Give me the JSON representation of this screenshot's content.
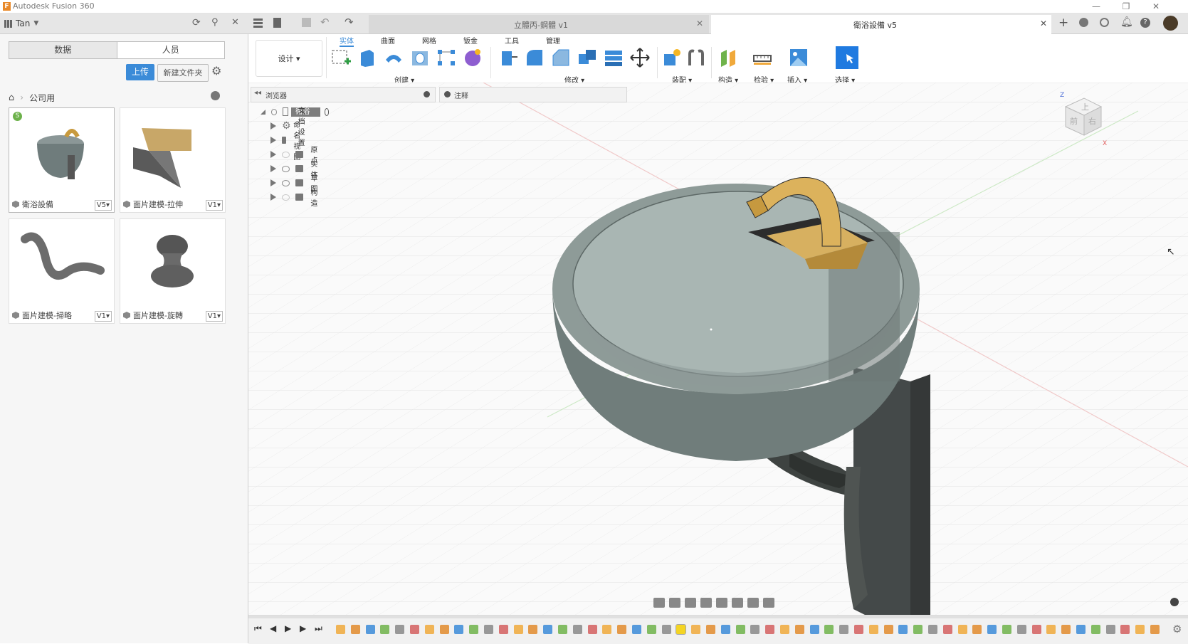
{
  "window": {
    "title": "Autodesk Fusion 360",
    "logo_letter": "F"
  },
  "user": {
    "name": "Tan"
  },
  "doc_tabs": [
    {
      "label": "立體丙-鋼體 v1",
      "active": false
    },
    {
      "label": "衛浴設備 v5",
      "active": true
    }
  ],
  "data_panel": {
    "tab_data": "数据",
    "tab_people": "人员",
    "upload": "上传",
    "new_folder": "新建文件夹",
    "breadcrumb": "公司用",
    "files": [
      {
        "name": "衛浴設備",
        "version": "V5"
      },
      {
        "name": "面片建模-拉伸",
        "version": "V1"
      },
      {
        "name": "面片建模-掃略",
        "version": "V1"
      },
      {
        "name": "面片建模-旋轉",
        "version": "V1"
      }
    ],
    "badge": "S"
  },
  "toolbar": {
    "workspace": "设计",
    "tabs": [
      "实体",
      "曲面",
      "网格",
      "钣金",
      "工具",
      "管理"
    ],
    "groups": [
      "创建",
      "修改",
      "装配",
      "构造",
      "检验",
      "插入",
      "选择"
    ]
  },
  "browser": {
    "title": "浏览器",
    "comments": "注释",
    "root": "衛浴設備 v5",
    "items": [
      "文档设置",
      "命名视图",
      "原点",
      "实体",
      "草图",
      "构造"
    ]
  },
  "viewcube": {
    "front": "前",
    "right": "右",
    "top": "上"
  },
  "colors": {
    "accent": "#3b8bd8",
    "brass": "#d9ab56",
    "bowl": "#7f9191"
  }
}
